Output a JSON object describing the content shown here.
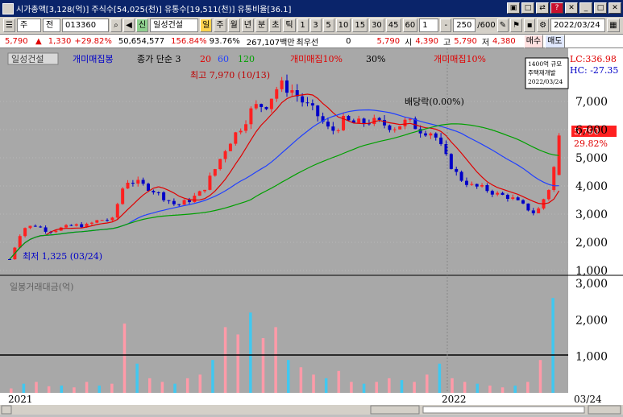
{
  "window": {
    "title": "시가총액[3,128(억)] 주식수[54,025(천)] 유통수[19,511(천)] 유통비율[36.1]",
    "buttons": [
      "▣",
      "□",
      "⇄",
      "?",
      "✕",
      "_",
      "□",
      "✕"
    ]
  },
  "toolbar": {
    "mode": "주",
    "market": "전",
    "code": "013360",
    "stock_name": "일성건설",
    "stock_tag": "신",
    "period_buttons": [
      "일",
      "주",
      "월",
      "년",
      "분",
      "초",
      "틱"
    ],
    "interval_buttons": [
      "1",
      "3",
      "5",
      "10",
      "15",
      "30",
      "45",
      "60"
    ],
    "interval_value": "1",
    "count": "250",
    "count_total": "/600",
    "date": "2022/03/24"
  },
  "info": {
    "price": "5,790",
    "change": "1,330",
    "change_pct": "+29.82%",
    "volume": "50,654,577",
    "volume_ratio": "156.84%",
    "rate2": "93.76%",
    "amount": "267,107백만",
    "preferred_label": "최우선",
    "preferred_value": "0",
    "current": "5,790",
    "open_label": "시",
    "open": "4,390",
    "high_label": "고",
    "high": "5,790",
    "low_label": "저",
    "low": "4,380",
    "buy_label": "매수",
    "sell_label": "매도"
  },
  "legend": {
    "stock": "일성건설",
    "gaemi": "개미매집봉",
    "ma_label": "종가 단순 3",
    "ma20": "20",
    "ma60": "60",
    "ma120": "120",
    "gaemi10a": "개미매집10%",
    "pct30": "30%",
    "gaemi10b": "개미매집10%"
  },
  "annotations": {
    "high": "최고 7,970 (10/13)",
    "low": "최저 1,325 (03/24)",
    "dividend": "배당락(0.00%)",
    "lc": "LC:336.98",
    "hc": "HC: -27.35",
    "note_lines": [
      "1400억 규모",
      "주택재개발",
      "2022/03/24"
    ],
    "price_tag": "5,790",
    "pct_tag": "29.82%",
    "volume_title": "일봉거래대금(억)"
  },
  "axes": {
    "price_ticks": [
      "7,000",
      "6,000",
      "5,000",
      "4,000",
      "3,000",
      "2,000",
      "1,000"
    ],
    "volume_ticks": [
      "3,000",
      "2,000",
      "1,000"
    ],
    "x_labels": [
      "2021",
      "2022",
      "03/24"
    ]
  },
  "colors": {
    "up": "#ff2020",
    "down": "#0000c8",
    "ma20": "#e00000",
    "ma60": "#2040ff",
    "ma120": "#00a000",
    "vol_up": "#ff9aa8",
    "vol_down": "#40c8f0",
    "bg": "#a8a8a8"
  },
  "chart_data": {
    "type": "line",
    "price_x": [
      0,
      5,
      10,
      15,
      20,
      25,
      30,
      35,
      40,
      45,
      50,
      55,
      60,
      65,
      70,
      75,
      80,
      85,
      90,
      95,
      100,
      105,
      110,
      115,
      120,
      125,
      130,
      135,
      140,
      145,
      150,
      155,
      160,
      165,
      170,
      175,
      180,
      185,
      190,
      195,
      200,
      205,
      210,
      215,
      220,
      225,
      230,
      235,
      240,
      245,
      250
    ],
    "price_close": [
      1400,
      2500,
      2600,
      2400,
      2500,
      2600,
      2600,
      2800,
      2800,
      4200,
      4100,
      3900,
      3600,
      3300,
      3500,
      3800,
      4600,
      5500,
      6100,
      6800,
      6900,
      7600,
      7400,
      6900,
      6500,
      5900,
      6300,
      6200,
      6300,
      6200,
      6100,
      6300,
      6000,
      5900,
      5000,
      4300,
      4000,
      3900,
      3700,
      3600,
      3300,
      3000,
      3900,
      5790,
      5790,
      5790,
      5790,
      5790,
      5790,
      5790,
      5790
    ],
    "volume_values": [
      120,
      250,
      300,
      180,
      200,
      150,
      300,
      200,
      250,
      1900,
      800,
      400,
      300,
      250,
      400,
      500,
      900,
      1800,
      1600,
      2200,
      1500,
      1800,
      900,
      700,
      500,
      400,
      600,
      300,
      250,
      300,
      400,
      350,
      300,
      500,
      800,
      400,
      300,
      250,
      200,
      150,
      200,
      300,
      900,
      2600
    ]
  }
}
